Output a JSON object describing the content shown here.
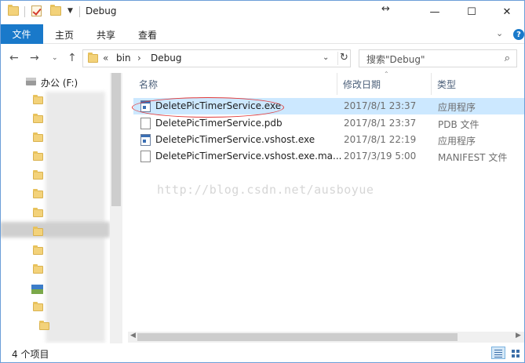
{
  "window": {
    "title": "Debug",
    "minimize_glyph": "—",
    "maximize_glyph": "☐",
    "close_glyph": "✕"
  },
  "ribbon": {
    "tabs": [
      "文件",
      "主页",
      "共享",
      "查看"
    ]
  },
  "address_bar": {
    "overflow": "«",
    "segments": [
      "bin",
      "Debug"
    ],
    "separator": "›"
  },
  "search": {
    "placeholder": "搜索\"Debug\""
  },
  "nav_pane": {
    "drive_label": "办公 (F:)"
  },
  "columns": {
    "name": "名称",
    "modified": "修改日期",
    "type": "类型"
  },
  "files": [
    {
      "name": "DeletePicTimerService.exe",
      "modified": "2017/8/1 23:37",
      "type": "应用程序",
      "icon": "exe-icon"
    },
    {
      "name": "DeletePicTimerService.pdb",
      "modified": "2017/8/1 23:37",
      "type": "PDB 文件",
      "icon": "document-icon"
    },
    {
      "name": "DeletePicTimerService.vshost.exe",
      "modified": "2017/8/1 22:19",
      "type": "应用程序",
      "icon": "exe-icon"
    },
    {
      "name": "DeletePicTimerService.vshost.exe.ma...",
      "modified": "2017/3/19 5:00",
      "type": "MANIFEST 文件",
      "icon": "document-icon"
    }
  ],
  "watermark": "http://blog.csdn.net/ausboyue",
  "status": {
    "item_count": "4 个项目"
  },
  "colors": {
    "accent": "#1979ca",
    "selection": "#cce8ff",
    "highlight_circle": "#e03a3a"
  }
}
